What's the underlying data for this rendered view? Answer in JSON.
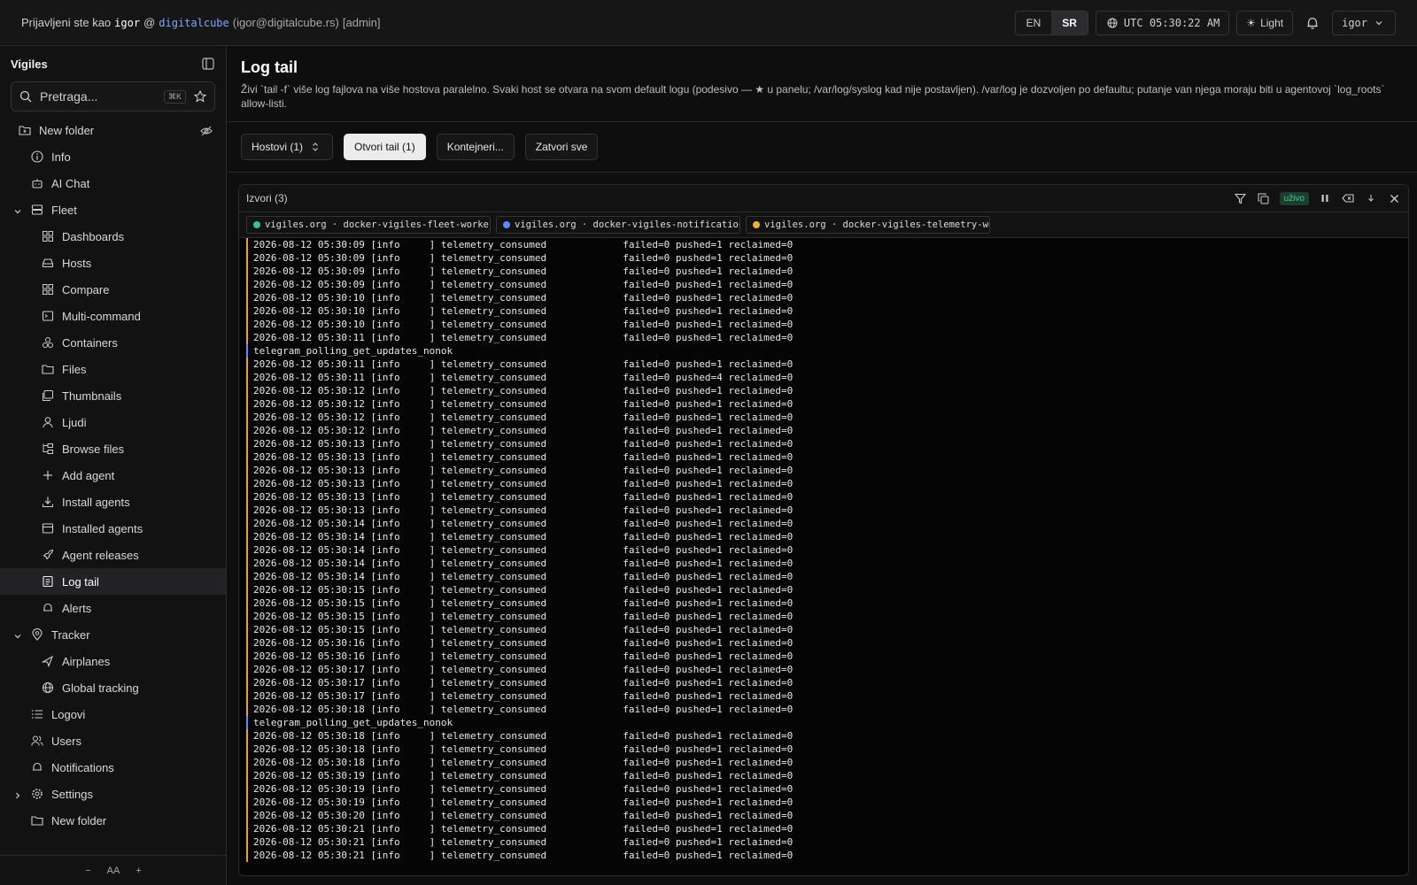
{
  "topbar": {
    "logged_in_prefix": "Prijavljeni ste kao",
    "username": "igor",
    "at": "@",
    "org": "digitalcube",
    "email": "(igor@digitalcube.rs)",
    "role": "[admin]",
    "lang_en": "EN",
    "lang_sr": "SR",
    "clock": "UTC 05:30:22 AM",
    "theme": "Light",
    "user_menu": "igor"
  },
  "sidebar": {
    "title": "Vigiles",
    "search_placeholder": "Pretraga...",
    "search_kbd": "⌘K",
    "items": [
      {
        "label": "New folder"
      },
      {
        "label": "Info"
      },
      {
        "label": "AI Chat"
      },
      {
        "label": "Fleet"
      },
      {
        "label": "Dashboards"
      },
      {
        "label": "Hosts"
      },
      {
        "label": "Compare"
      },
      {
        "label": "Multi-command"
      },
      {
        "label": "Containers"
      },
      {
        "label": "Files"
      },
      {
        "label": "Thumbnails"
      },
      {
        "label": "Ljudi"
      },
      {
        "label": "Browse files"
      },
      {
        "label": "Add agent"
      },
      {
        "label": "Install agents"
      },
      {
        "label": "Installed agents"
      },
      {
        "label": "Agent releases"
      },
      {
        "label": "Log tail"
      },
      {
        "label": "Alerts"
      },
      {
        "label": "Tracker"
      },
      {
        "label": "Airplanes"
      },
      {
        "label": "Global tracking"
      },
      {
        "label": "Logovi"
      },
      {
        "label": "Users"
      },
      {
        "label": "Notifications"
      },
      {
        "label": "Settings"
      },
      {
        "label": "New folder"
      }
    ],
    "footer": {
      "minus": "−",
      "aa": "AA",
      "plus": "+"
    }
  },
  "page": {
    "title": "Log tail",
    "description": "Živi `tail -f` više log fajlova na više hostova paralelno. Svaki host se otvara na svom default logu (podesivo — ★ u panelu; /var/log/syslog kad nije postavljen). /var/log je dozvoljen po defaultu; putanje van njega moraju biti u agentovoj `log_roots` allow-listi."
  },
  "controls": {
    "hosts": "Hostovi (1)",
    "open_tail": "Otvori tail (1)",
    "containers": "Kontejneri...",
    "close_all": "Zatvori sve"
  },
  "panel": {
    "title": "Izvori (3)",
    "live_badge": "uživo",
    "sources": [
      {
        "label": "vigiles.org · docker-vigiles-fleet-worker…",
        "color": "#35c48a"
      },
      {
        "label": "vigiles.org · docker-vigiles-notification…",
        "color": "#5a8cff"
      },
      {
        "label": "vigiles.org · docker-vigiles-telemetry-wo…",
        "color": "#f0b429"
      }
    ],
    "lines": [
      "2026-08-12 05:30:09 [info     ] telemetry_consumed             failed=0 pushed=1 reclaimed=0",
      "2026-08-12 05:30:09 [info     ] telemetry_consumed             failed=0 pushed=1 reclaimed=0",
      "2026-08-12 05:30:09 [info     ] telemetry_consumed             failed=0 pushed=1 reclaimed=0",
      "2026-08-12 05:30:09 [info     ] telemetry_consumed             failed=0 pushed=1 reclaimed=0",
      "2026-08-12 05:30:10 [info     ] telemetry_consumed             failed=0 pushed=1 reclaimed=0",
      "2026-08-12 05:30:10 [info     ] telemetry_consumed             failed=0 pushed=1 reclaimed=0",
      "2026-08-12 05:30:10 [info     ] telemetry_consumed             failed=0 pushed=1 reclaimed=0",
      "2026-08-12 05:30:11 [info     ] telemetry_consumed             failed=0 pushed=1 reclaimed=0",
      "telegram_polling_get_updates_nonok",
      "2026-08-12 05:30:11 [info     ] telemetry_consumed             failed=0 pushed=1 reclaimed=0",
      "2026-08-12 05:30:11 [info     ] telemetry_consumed             failed=0 pushed=4 reclaimed=0",
      "2026-08-12 05:30:12 [info     ] telemetry_consumed             failed=0 pushed=1 reclaimed=0",
      "2026-08-12 05:30:12 [info     ] telemetry_consumed             failed=0 pushed=1 reclaimed=0",
      "2026-08-12 05:30:12 [info     ] telemetry_consumed             failed=0 pushed=1 reclaimed=0",
      "2026-08-12 05:30:12 [info     ] telemetry_consumed             failed=0 pushed=1 reclaimed=0",
      "2026-08-12 05:30:13 [info     ] telemetry_consumed             failed=0 pushed=1 reclaimed=0",
      "2026-08-12 05:30:13 [info     ] telemetry_consumed             failed=0 pushed=1 reclaimed=0",
      "2026-08-12 05:30:13 [info     ] telemetry_consumed             failed=0 pushed=1 reclaimed=0",
      "2026-08-12 05:30:13 [info     ] telemetry_consumed             failed=0 pushed=1 reclaimed=0",
      "2026-08-12 05:30:13 [info     ] telemetry_consumed             failed=0 pushed=1 reclaimed=0",
      "2026-08-12 05:30:13 [info     ] telemetry_consumed             failed=0 pushed=1 reclaimed=0",
      "2026-08-12 05:30:14 [info     ] telemetry_consumed             failed=0 pushed=1 reclaimed=0",
      "2026-08-12 05:30:14 [info     ] telemetry_consumed             failed=0 pushed=1 reclaimed=0",
      "2026-08-12 05:30:14 [info     ] telemetry_consumed             failed=0 pushed=1 reclaimed=0",
      "2026-08-12 05:30:14 [info     ] telemetry_consumed             failed=0 pushed=1 reclaimed=0",
      "2026-08-12 05:30:14 [info     ] telemetry_consumed             failed=0 pushed=1 reclaimed=0",
      "2026-08-12 05:30:15 [info     ] telemetry_consumed             failed=0 pushed=1 reclaimed=0",
      "2026-08-12 05:30:15 [info     ] telemetry_consumed             failed=0 pushed=1 reclaimed=0",
      "2026-08-12 05:30:15 [info     ] telemetry_consumed             failed=0 pushed=1 reclaimed=0",
      "2026-08-12 05:30:15 [info     ] telemetry_consumed             failed=0 pushed=1 reclaimed=0",
      "2026-08-12 05:30:16 [info     ] telemetry_consumed             failed=0 pushed=1 reclaimed=0",
      "2026-08-12 05:30:16 [info     ] telemetry_consumed             failed=0 pushed=1 reclaimed=0",
      "2026-08-12 05:30:17 [info     ] telemetry_consumed             failed=0 pushed=1 reclaimed=0",
      "2026-08-12 05:30:17 [info     ] telemetry_consumed             failed=0 pushed=1 reclaimed=0",
      "2026-08-12 05:30:17 [info     ] telemetry_consumed             failed=0 pushed=1 reclaimed=0",
      "2026-08-12 05:30:18 [info     ] telemetry_consumed             failed=0 pushed=1 reclaimed=0",
      "telegram_polling_get_updates_nonok",
      "2026-08-12 05:30:18 [info     ] telemetry_consumed             failed=0 pushed=1 reclaimed=0",
      "2026-08-12 05:30:18 [info     ] telemetry_consumed             failed=0 pushed=1 reclaimed=0",
      "2026-08-12 05:30:18 [info     ] telemetry_consumed             failed=0 pushed=1 reclaimed=0",
      "2026-08-12 05:30:19 [info     ] telemetry_consumed             failed=0 pushed=1 reclaimed=0",
      "2026-08-12 05:30:19 [info     ] telemetry_consumed             failed=0 pushed=1 reclaimed=0",
      "2026-08-12 05:30:19 [info     ] telemetry_consumed             failed=0 pushed=1 reclaimed=0",
      "2026-08-12 05:30:20 [info     ] telemetry_consumed             failed=0 pushed=1 reclaimed=0",
      "2026-08-12 05:30:21 [info     ] telemetry_consumed             failed=0 pushed=1 reclaimed=0",
      "2026-08-12 05:30:21 [info     ] telemetry_consumed             failed=0 pushed=1 reclaimed=0",
      "2026-08-12 05:30:21 [info     ] telemetry_consumed             failed=0 pushed=1 reclaimed=0"
    ]
  },
  "icons": {
    "folder": "folder-plus-icon",
    "info": "info-icon",
    "chat": "bot-icon",
    "fleet": "server-icon"
  }
}
